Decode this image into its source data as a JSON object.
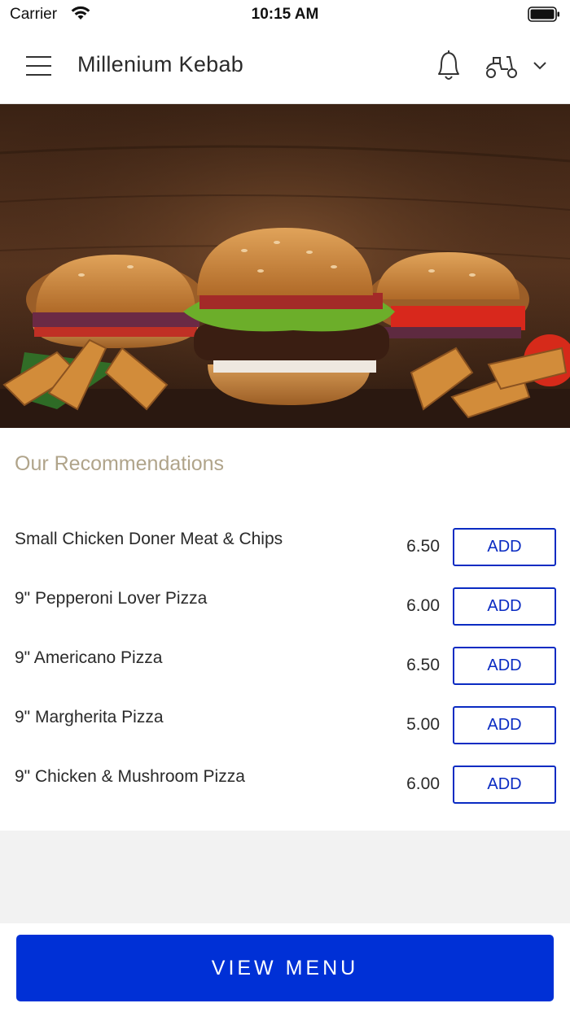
{
  "status_bar": {
    "carrier": "Carrier",
    "time": "10:15 AM"
  },
  "header": {
    "title": "Millenium Kebab"
  },
  "icons": {
    "menu": "hamburger-menu-icon",
    "notifications": "bell-icon",
    "order_mode": "delivery-scooter-icon",
    "dropdown": "chevron-down-icon"
  },
  "hero": {
    "alt": "burgers-with-potato-wedges"
  },
  "recommendations": {
    "title": "Our Recommendations",
    "items": [
      {
        "name": "Small Chicken Doner Meat & Chips",
        "price": "6.50",
        "action": "ADD"
      },
      {
        "name": "9\" Pepperoni Lover Pizza",
        "price": "6.00",
        "action": "ADD"
      },
      {
        "name": "9\" Americano Pizza",
        "price": "6.50",
        "action": "ADD"
      },
      {
        "name": "9\" Margherita Pizza",
        "price": "5.00",
        "action": "ADD"
      },
      {
        "name": "9\" Chicken & Mushroom Pizza",
        "price": "6.00",
        "action": "ADD"
      }
    ]
  },
  "footer": {
    "button_label": "VIEW MENU"
  },
  "colors": {
    "accent": "#0030d6",
    "add_button": "#0a2bc2",
    "section_title": "#b0a48a",
    "page_background": "#f2f2f2"
  }
}
